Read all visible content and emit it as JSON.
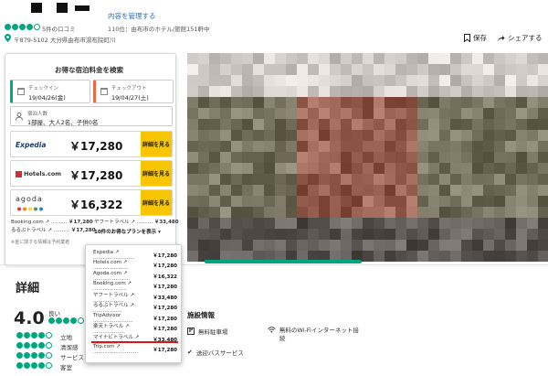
{
  "header": {
    "manage_link": "内容を管理する",
    "reviews": "5件の口コミ",
    "rank": "110位：由布市のホテル/旅館151軒中",
    "address": "〒879-5102 大分県由布市湯布院町川",
    "save": "保存",
    "share": "シェアする"
  },
  "price_panel": {
    "title": "お得な宿泊料金を検索",
    "checkin": {
      "label": "チェックイン",
      "value": "19/04/26(金)"
    },
    "checkout": {
      "label": "チェックアウト",
      "value": "19/04/27(土)"
    },
    "guests": {
      "label": "宿泊人数",
      "value": "1部屋、大人2名、子供0名"
    },
    "vendors": [
      {
        "name": "Expedia",
        "price": "￥17,280",
        "button": "詳細を見る"
      },
      {
        "name": "Hotels.com",
        "price": "￥17,280",
        "button": "詳細を見る"
      },
      {
        "name": "agoda",
        "price": "￥16,322",
        "button": "詳細を見る"
      }
    ],
    "other_left": [
      {
        "name": "Booking.com ↗ ..........",
        "price": "￥17,280"
      },
      {
        "name": "るるぶトラベル ↗ ..........",
        "price": "￥17,280"
      }
    ],
    "other_right": [
      {
        "name": "ヤフートラベル ↗ ..........",
        "price": "￥33,480"
      }
    ],
    "show_all": "10件のお得なプランを表示 ▾",
    "footnote": "※金に関する情報は予約業者"
  },
  "dropdown": [
    {
      "name": "Expedia ↗ ..........................",
      "price": "￥17,280"
    },
    {
      "name": "Hotels.com ↗ ......................",
      "price": "￥17,280"
    },
    {
      "name": "Agoda.com ↗ .......................",
      "price": "￥16,322"
    },
    {
      "name": "Booking.com ↗ .....................",
      "price": "￥17,280"
    },
    {
      "name": "ヤフートラベル ↗ ...................",
      "price": "￥33,480"
    },
    {
      "name": "るるぶトラベル ↗ ..................",
      "price": "￥17,280"
    },
    {
      "name": "TripAdvisor .........................",
      "price": "￥17,280"
    },
    {
      "name": "楽天トラベル ↗ ....................",
      "price": "￥17,280"
    },
    {
      "name": "マイナビトラベル ↗ ...............",
      "price": "￥33,480"
    },
    {
      "name": "Trip.com ↗ ............................",
      "price": "￥17,280"
    }
  ],
  "details": {
    "title": "詳細",
    "score": "4.0",
    "score_word": "良い",
    "subratings": [
      "立地",
      "清潔感",
      "サービス",
      "客室"
    ]
  },
  "amenities": {
    "title": "施設情報",
    "items": [
      "無料駐車場",
      "無料のWi-Fiインターネット接続",
      "送迎バスサービス"
    ]
  },
  "colors": {
    "brand_green": "#00a680",
    "button_yellow": "#f7c600",
    "link_blue": "#2f6eb5",
    "highlight_red": "#e3140e"
  }
}
